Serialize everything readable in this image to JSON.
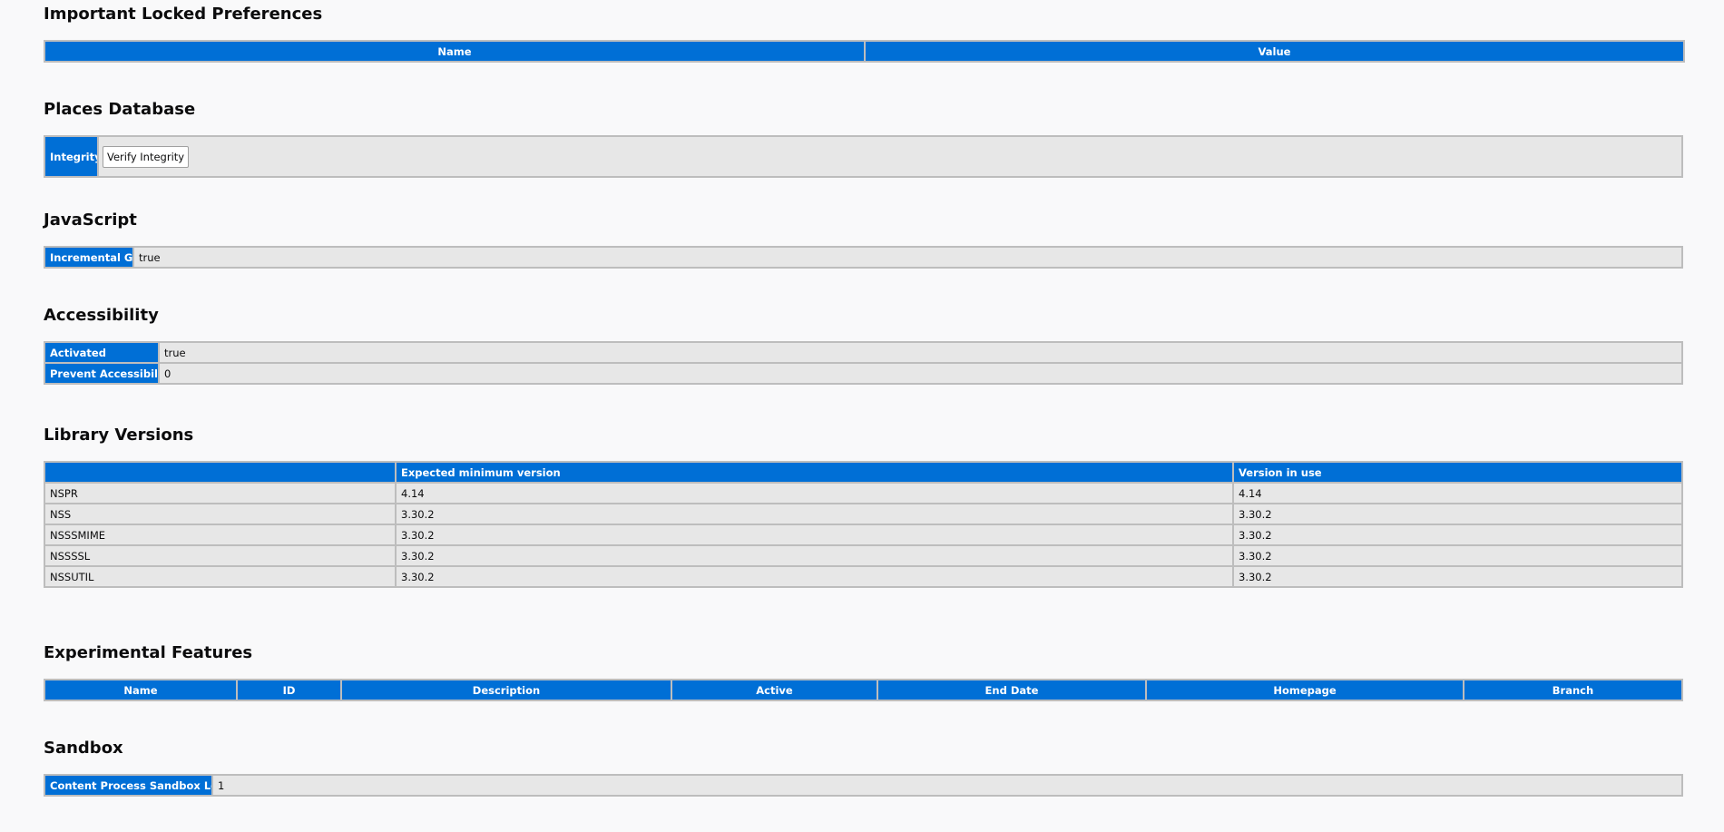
{
  "locked_prefs": {
    "title": "Important Locked Preferences",
    "columns": [
      "Name",
      "Value"
    ]
  },
  "places": {
    "title": "Places Database",
    "row_label": "Integrity",
    "button_label": "Verify Integrity"
  },
  "javascript": {
    "title": "JavaScript",
    "rows": [
      {
        "label": "Incremental GC",
        "value": "true"
      }
    ]
  },
  "accessibility": {
    "title": "Accessibility",
    "rows": [
      {
        "label": "Activated",
        "value": "true"
      },
      {
        "label": "Prevent Accessibility",
        "value": "0"
      }
    ]
  },
  "library_versions": {
    "title": "Library Versions",
    "columns": [
      "",
      "Expected minimum version",
      "Version in use"
    ],
    "rows": [
      {
        "name": "NSPR",
        "expected": "4.14",
        "in_use": "4.14"
      },
      {
        "name": "NSS",
        "expected": "3.30.2",
        "in_use": "3.30.2"
      },
      {
        "name": "NSSSMIME",
        "expected": "3.30.2",
        "in_use": "3.30.2"
      },
      {
        "name": "NSSSSL",
        "expected": "3.30.2",
        "in_use": "3.30.2"
      },
      {
        "name": "NSSUTIL",
        "expected": "3.30.2",
        "in_use": "3.30.2"
      }
    ]
  },
  "experimental": {
    "title": "Experimental Features",
    "columns": [
      "Name",
      "ID",
      "Description",
      "Active",
      "End Date",
      "Homepage",
      "Branch"
    ]
  },
  "sandbox": {
    "title": "Sandbox",
    "rows": [
      {
        "label": "Content Process Sandbox Level",
        "value": "1"
      }
    ]
  },
  "colors": {
    "header_bg": "#006fd6",
    "cell_bg": "#e7e7e7",
    "border": "#bdbdbd",
    "page_bg": "#f9f9fa"
  }
}
